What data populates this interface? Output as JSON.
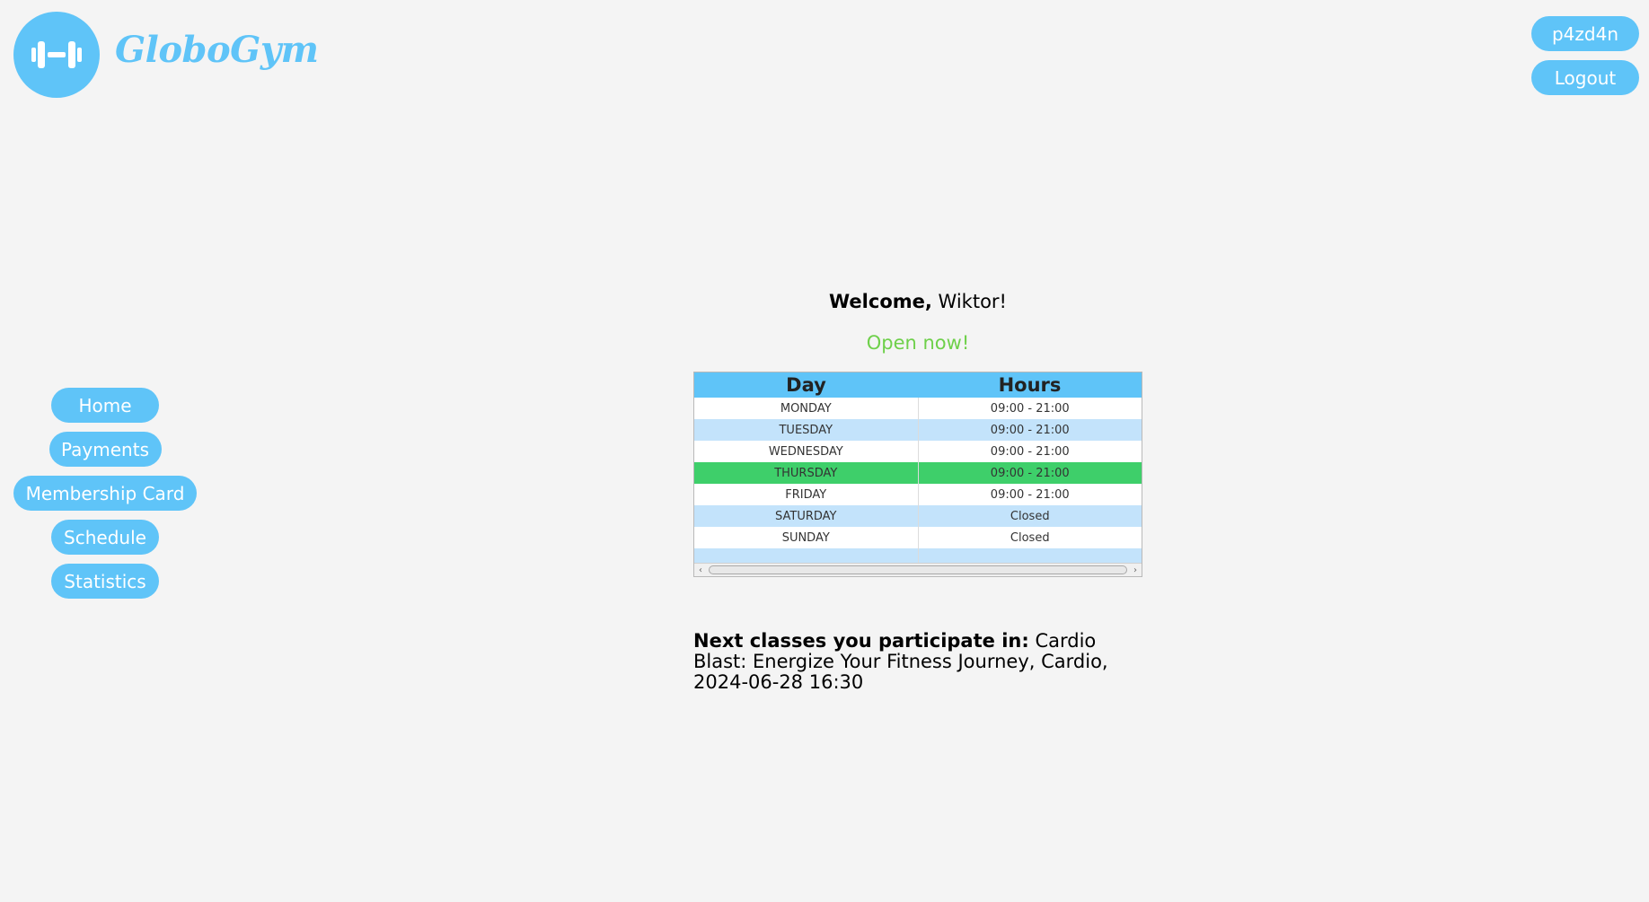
{
  "brand": {
    "name": "GloboGym"
  },
  "header": {
    "username": "p4zd4n",
    "logout_label": "Logout"
  },
  "sidebar": {
    "items": [
      {
        "label": "Home"
      },
      {
        "label": "Payments"
      },
      {
        "label": "Membership Card"
      },
      {
        "label": "Schedule"
      },
      {
        "label": "Statistics"
      }
    ]
  },
  "main": {
    "welcome_prefix": "Welcome,",
    "welcome_name": "Wiktor!",
    "status": "Open now!",
    "status_color": "#6ed04a",
    "hours_table": {
      "headers": [
        "Day",
        "Hours"
      ],
      "rows": [
        [
          "MONDAY",
          "09:00 - 21:00"
        ],
        [
          "TUESDAY",
          "09:00 - 21:00"
        ],
        [
          "WEDNESDAY",
          "09:00 - 21:00"
        ],
        [
          "THURSDAY",
          "09:00 - 21:00"
        ],
        [
          "FRIDAY",
          "09:00 - 21:00"
        ],
        [
          "SATURDAY",
          "Closed"
        ],
        [
          "SUNDAY",
          "Closed"
        ]
      ],
      "highlight_row_color": "#3ecf6a"
    },
    "next_classes_label": "Next classes you participate in:",
    "next_classes_value": "Cardio Blast: Energize Your Fitness Journey, Cardio, 2024-06-28 16:30"
  },
  "colors": {
    "accent": "#5fc4f8",
    "background": "#f4f4f4"
  }
}
